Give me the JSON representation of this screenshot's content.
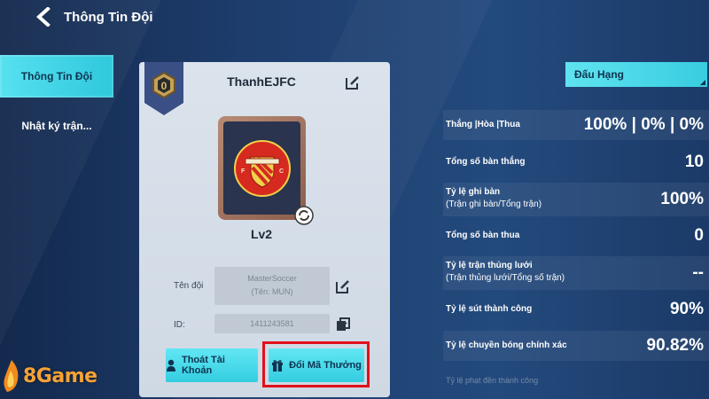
{
  "header": {
    "title": "Thông Tin Đội",
    "back_icon": "back-arrow-icon"
  },
  "sidebar": {
    "items": [
      {
        "label": "Thông Tin Đội",
        "active": true
      },
      {
        "label": "Nhật ký trận..."
      }
    ]
  },
  "card": {
    "rank_badge": "0",
    "team_name": "ThanhEJFC",
    "level": "Lv2",
    "crest_icon": "manchester-fc-crest",
    "fields": {
      "team_label": "Tên đội",
      "team_value": "MasterSoccer",
      "team_short": "(Tên: MUN)",
      "id_label": "ID:",
      "id_value": "1411243581"
    },
    "buttons": {
      "logout": "Thoát Tài Khoản",
      "redeem": "Đổi Mã Thưởng"
    }
  },
  "right": {
    "dropdown": "Đấu Hạng",
    "stats": [
      {
        "label": "Thắng |Hòa |Thua",
        "sublabel": "",
        "value": "100% | 0% | 0%"
      },
      {
        "label": "Tổng số bàn thắng",
        "sublabel": "",
        "value": "10"
      },
      {
        "label": "Tỷ lệ ghi bàn",
        "sublabel": "(Trận ghi bàn/Tổng trận)",
        "value": "100%"
      },
      {
        "label": "Tổng số bàn thua",
        "sublabel": "",
        "value": "0"
      },
      {
        "label": "Tỷ lệ trận thủng lưới",
        "sublabel": "(Trận thủng lưới/Tổng số trận)",
        "value": "--"
      },
      {
        "label": "Tỷ lệ sút thành công",
        "sublabel": "",
        "value": "90%"
      },
      {
        "label": "Tỷ lệ chuyền bóng chính xác",
        "sublabel": "",
        "value": "90.82%"
      }
    ],
    "faded_row": "Tỷ lệ phạt đền thành công"
  },
  "watermark": {
    "text": "8Game"
  },
  "colors": {
    "accent": "#3fd3e4",
    "highlight": "#e0101c",
    "background": "#1d3a66",
    "card": "#d6dfe8"
  }
}
